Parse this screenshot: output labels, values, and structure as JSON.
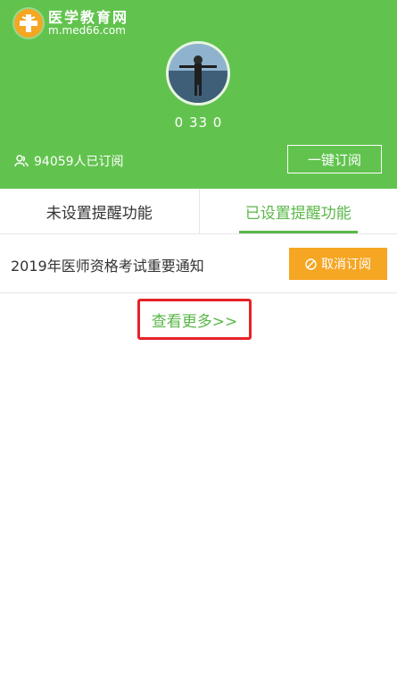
{
  "header": {
    "logo_name": "医学教育网",
    "logo_url": "m.med66.com",
    "user_stats": "0 33 0",
    "subscriber_count": "94059人已订阅",
    "subscribe_all_label": "一键订阅"
  },
  "tabs": [
    {
      "label": "未设置提醒功能",
      "active": false
    },
    {
      "label": "已设置提醒功能",
      "active": true
    }
  ],
  "list": {
    "items": [
      {
        "title": "2019年医师资格考试重要通知",
        "action_label": "取消订阅"
      }
    ]
  },
  "view_more_label": "查看更多>>",
  "colors": {
    "header_green": "#61c34e",
    "accent_green": "#5bb749",
    "button_orange": "#f5a623",
    "highlight_red": "#e62329"
  }
}
